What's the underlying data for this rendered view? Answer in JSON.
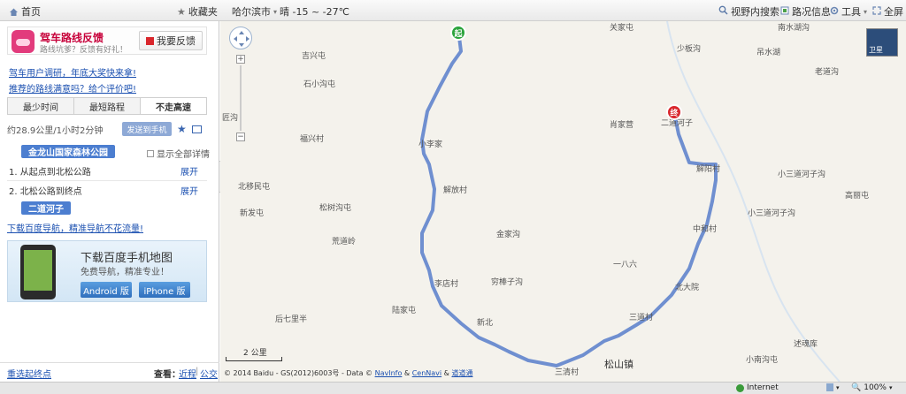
{
  "topbar": {
    "home": "首页",
    "favorites": "收藏夹",
    "city": "哈尔滨市",
    "weather": "晴 -15 ~ -27℃",
    "search_view": "视野内搜索",
    "traffic": "路况信息",
    "tools": "工具",
    "fullscreen": "全屏"
  },
  "feedback": {
    "title": "驾车路线反馈",
    "subtitle": "路线坑爹？反馈有好礼！",
    "button": "我要反馈"
  },
  "links": {
    "survey": "驾车用户调研，年底大奖快来拿!",
    "rate": "推荐的路线满意吗？给个评价吧!"
  },
  "tabs": [
    "最少时间",
    "最短路程",
    "不走高速"
  ],
  "route": {
    "summary": "约28.9公里/1小时2分钟",
    "send": "发送到手机",
    "start": "金龙山国家森林公园",
    "show_all": "显示全部详情",
    "steps": [
      {
        "text": "1. 从起点到北松公路",
        "action": "展开"
      },
      {
        "text": "2. 北松公路到终点",
        "action": "展开"
      }
    ],
    "end": "二道河子",
    "nav_link": "下载百度导航，精准导航不花流量!"
  },
  "ad": {
    "title": "下载百度手机地图",
    "subtitle": "免费导航，精准专业！",
    "android": "Android 版",
    "iphone": "iPhone 版"
  },
  "left_footer": {
    "reselect": "重选起终点",
    "view": "查看：",
    "nearby": "近程",
    "bus": "公交"
  },
  "map": {
    "satellite": "卫星",
    "scale": "2 公里",
    "copyright_prefix": "© 2014 Baidu - GS(2012)6003号 - Data ©",
    "navinfo": "NavInfo",
    "cennavi": "CenNavi",
    "daoda": "道道通",
    "amp": "&",
    "start_marker": "起",
    "end_marker": "终",
    "labels": [
      {
        "t": "吉兴屯"
      },
      {
        "t": "石小沟屯"
      },
      {
        "t": "福兴村"
      },
      {
        "t": "匠沟"
      },
      {
        "t": "北移民屯"
      },
      {
        "t": "新发屯"
      },
      {
        "t": "松树沟屯"
      },
      {
        "t": "荒道岭"
      },
      {
        "t": "后七里半"
      },
      {
        "t": "陆家屯"
      },
      {
        "t": "李店村"
      },
      {
        "t": "穷棒子沟"
      },
      {
        "t": "金家沟"
      },
      {
        "t": "解放村"
      },
      {
        "t": "小李家"
      },
      {
        "t": "肖家营"
      },
      {
        "t": "少板沟"
      },
      {
        "t": "吊水湖"
      },
      {
        "t": "南水湖沟"
      },
      {
        "t": "老道沟"
      },
      {
        "t": "二道河子"
      },
      {
        "t": "解阳村"
      },
      {
        "t": "小三道河子沟"
      },
      {
        "t": "高丽屯"
      },
      {
        "t": "小三道河子沟"
      },
      {
        "t": "中和村"
      },
      {
        "t": "一八六"
      },
      {
        "t": "北大院"
      },
      {
        "t": "三道村"
      },
      {
        "t": "小南沟屯"
      },
      {
        "t": "述魂库"
      },
      {
        "t": "松山镇"
      },
      {
        "t": "三清村"
      },
      {
        "t": "新北"
      },
      {
        "t": "关家屯"
      }
    ]
  },
  "status": {
    "zone": "Internet",
    "zoom": "100%"
  },
  "colors": {
    "route": "#6f8fd0",
    "map_bg": "#f4f2ec",
    "start": "#2aa33b",
    "end": "#d9262c",
    "place_tag": "#4c7ed0"
  }
}
